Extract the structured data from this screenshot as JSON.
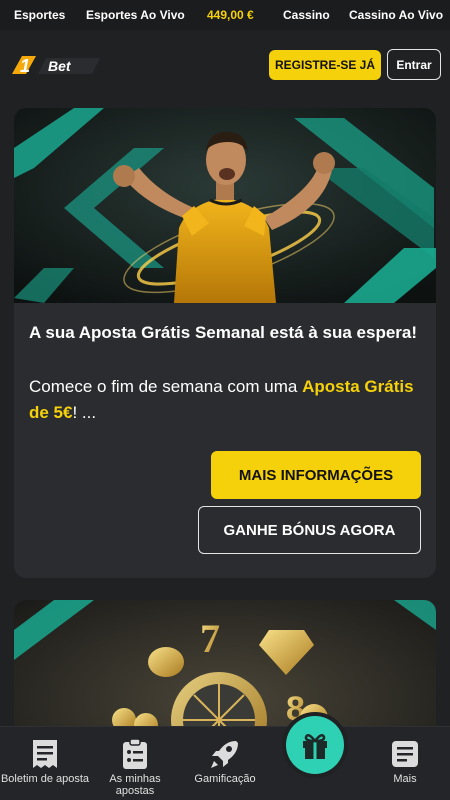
{
  "topnav": {
    "sports": "Esportes",
    "live": "Esportes Ao Vivo",
    "balance": "449,00 €",
    "casino": "Cassino",
    "live_casino": "Cassino Ao Vivo"
  },
  "header": {
    "logo_text": "1Bet",
    "register_label": "REGISTRE-SE JÁ",
    "login_label": "Entrar"
  },
  "promo": {
    "title": "A sua Aposta Grátis Semanal está à sua espera!",
    "desc_before": "Comece o fim de semana com uma ",
    "desc_highlight": "Aposta Grátis de 5€",
    "desc_after": "! ...",
    "more_label": "MAIS INFORMAÇÕES",
    "bonus_label": "GANHE BÓNUS AGORA"
  },
  "bottomnav": {
    "betslip": "Boletim de aposta",
    "mybets": "As minhas apostas",
    "gamification": "Gamificação",
    "more": "Mais"
  },
  "colors": {
    "accent": "#f5d10b",
    "teal": "#2fd1b4",
    "background": "#1f2123",
    "card": "#2a2c2f"
  }
}
